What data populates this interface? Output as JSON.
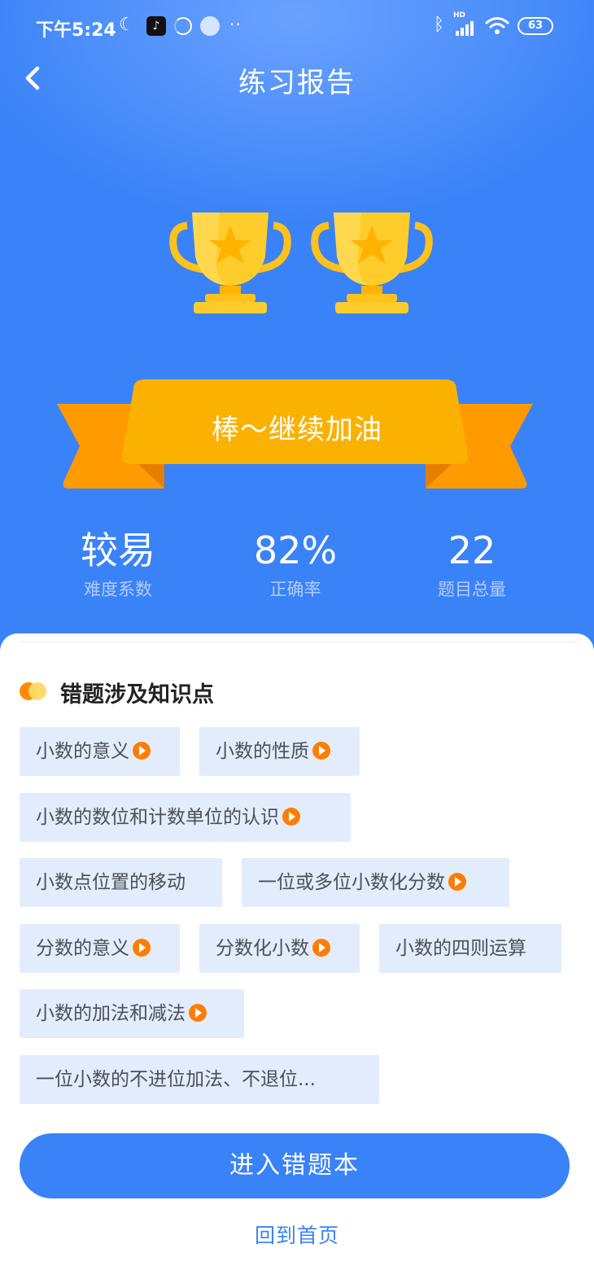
{
  "status_bar": {
    "time": "下午5:24",
    "icons": [
      "moon-icon",
      "tiktok-icon",
      "loading-ring-icon",
      "cloud-app-icon",
      "more-dots-icon",
      "bluetooth-icon",
      "signal-icon",
      "wifi-icon",
      "battery-icon"
    ],
    "battery": "63",
    "network": "HD"
  },
  "header": {
    "title": "练习报告"
  },
  "ribbon": {
    "text": "棒～继续加油"
  },
  "stats": [
    {
      "value": "较易",
      "label": "难度系数"
    },
    {
      "value": "82%",
      "label": "正确率"
    },
    {
      "value": "22",
      "label": "题目总量"
    }
  ],
  "section": {
    "title": "错题涉及知识点"
  },
  "tags": [
    {
      "label": "小数的意义",
      "video": true
    },
    {
      "label": "小数的性质",
      "video": true
    },
    {
      "label": "小数的数位和计数单位的认识",
      "video": true
    },
    {
      "label": "小数点位置的移动",
      "video": false
    },
    {
      "label": "一位或多位小数化分数",
      "video": true
    },
    {
      "label": "分数的意义",
      "video": true
    },
    {
      "label": "分数化小数",
      "video": true
    },
    {
      "label": "小数的四则运算",
      "video": false
    },
    {
      "label": "小数的加法和减法",
      "video": true
    },
    {
      "label": "一位小数的不进位加法、不退位...",
      "video": false
    }
  ],
  "actions": {
    "primary": "进入错题本",
    "secondary": "回到首页"
  },
  "colors": {
    "primary_blue": "#3a82f7",
    "ribbon_orange": "#fbb100",
    "accent_orange": "#ff7d00",
    "tag_bg": "#e3ecfc"
  }
}
